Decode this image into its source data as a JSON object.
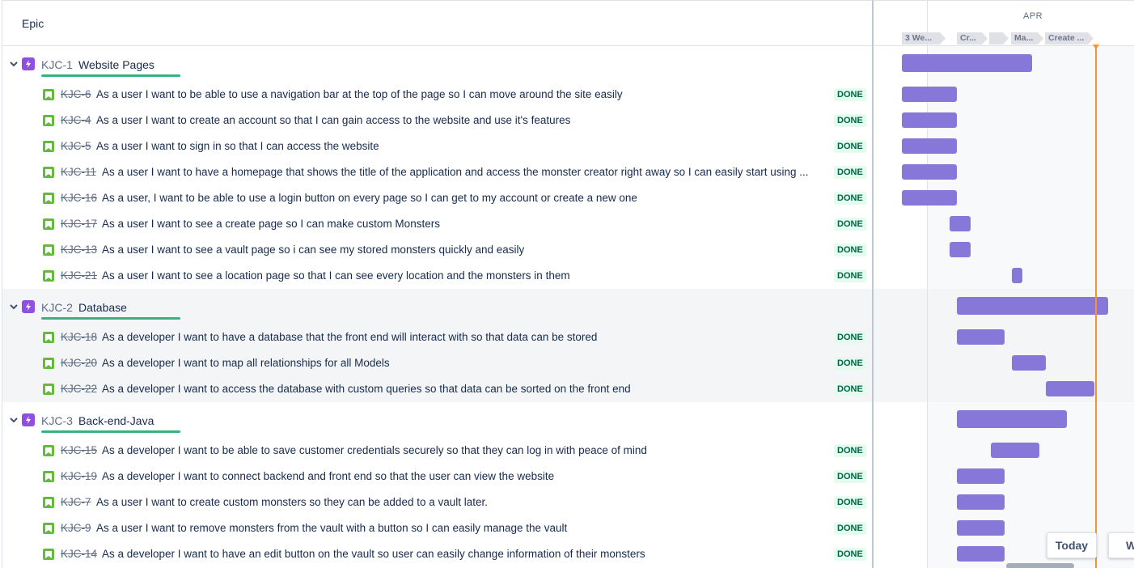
{
  "header": {
    "column_title": "Epic"
  },
  "timeline": {
    "month": "APR",
    "sprints": [
      "3 We...",
      "Cr...",
      "",
      "Ma...",
      "Create ..."
    ],
    "today_label": "Today",
    "weeks_label": "W",
    "colors": {
      "bar": "#8777d9",
      "today_line": "#f79232",
      "epic_icon": "#904ee2",
      "story_icon": "#63ba3c",
      "progress": "#36b37e"
    }
  },
  "epics": [
    {
      "key": "KJC-1",
      "title": "Website Pages",
      "expand_icon": "chevron-down-icon",
      "icon": "lightning-icon",
      "stories": [
        {
          "key": "KJC-6",
          "title": "As a user I want to be able to use a navigation bar at the top of the page so I can move around the site easily",
          "status": "DONE"
        },
        {
          "key": "KJC-4",
          "title": "As a user I want to create an account so that I can gain access to the website and use it's features",
          "status": "DONE"
        },
        {
          "key": "KJC-5",
          "title": "As a user I want to sign in so that I can access the website",
          "status": "DONE"
        },
        {
          "key": "KJC-11",
          "title": "As a user I want to have a homepage that shows the title of the application and access the monster creator right away so I can easily start using ...",
          "status": "DONE"
        },
        {
          "key": "KJC-16",
          "title": "As a user, I want to be able to use a login button on every page so I can get to my account or create a new one",
          "status": "DONE"
        },
        {
          "key": "KJC-17",
          "title": "As a user I want to see a create page so I can make custom Monsters",
          "status": "DONE"
        },
        {
          "key": "KJC-13",
          "title": "As a user I want to see a vault page so i can see my stored monsters quickly and easily",
          "status": "DONE"
        },
        {
          "key": "KJC-21",
          "title": "As a user I want to see a location page so that I can see every location and the monsters in them",
          "status": "DONE"
        }
      ]
    },
    {
      "key": "KJC-2",
      "title": "Database",
      "expand_icon": "chevron-down-icon",
      "icon": "lightning-icon",
      "stories": [
        {
          "key": "KJC-18",
          "title": "As a developer I want to have a database that the front end will interact with so that data can be stored",
          "status": "DONE"
        },
        {
          "key": "KJC-20",
          "title": "As a developer I want to map all relationships for all Models",
          "status": "DONE"
        },
        {
          "key": "KJC-22",
          "title": "As a developer I want to access the database with custom queries so that data can be sorted on the front end",
          "status": "DONE"
        }
      ]
    },
    {
      "key": "KJC-3",
      "title": "Back-end-Java",
      "expand_icon": "chevron-down-icon",
      "icon": "lightning-icon",
      "stories": [
        {
          "key": "KJC-15",
          "title": "As a developer I want to be able to save customer credentials securely so that they can log in with peace of mind",
          "status": "DONE"
        },
        {
          "key": "KJC-19",
          "title": "As a developer I want to connect backend and front end so that the user can view the website",
          "status": "DONE"
        },
        {
          "key": "KJC-7",
          "title": "As a user I want to create custom monsters so they can be added to a vault later.",
          "status": "DONE"
        },
        {
          "key": "KJC-9",
          "title": "As a user I want to remove monsters from the vault with a button so I can easily manage the vault",
          "status": "DONE"
        },
        {
          "key": "KJC-14",
          "title": "As a developer I want to have an edit button on the vault so user can easily change information of their monsters",
          "status": "DONE"
        }
      ]
    }
  ]
}
